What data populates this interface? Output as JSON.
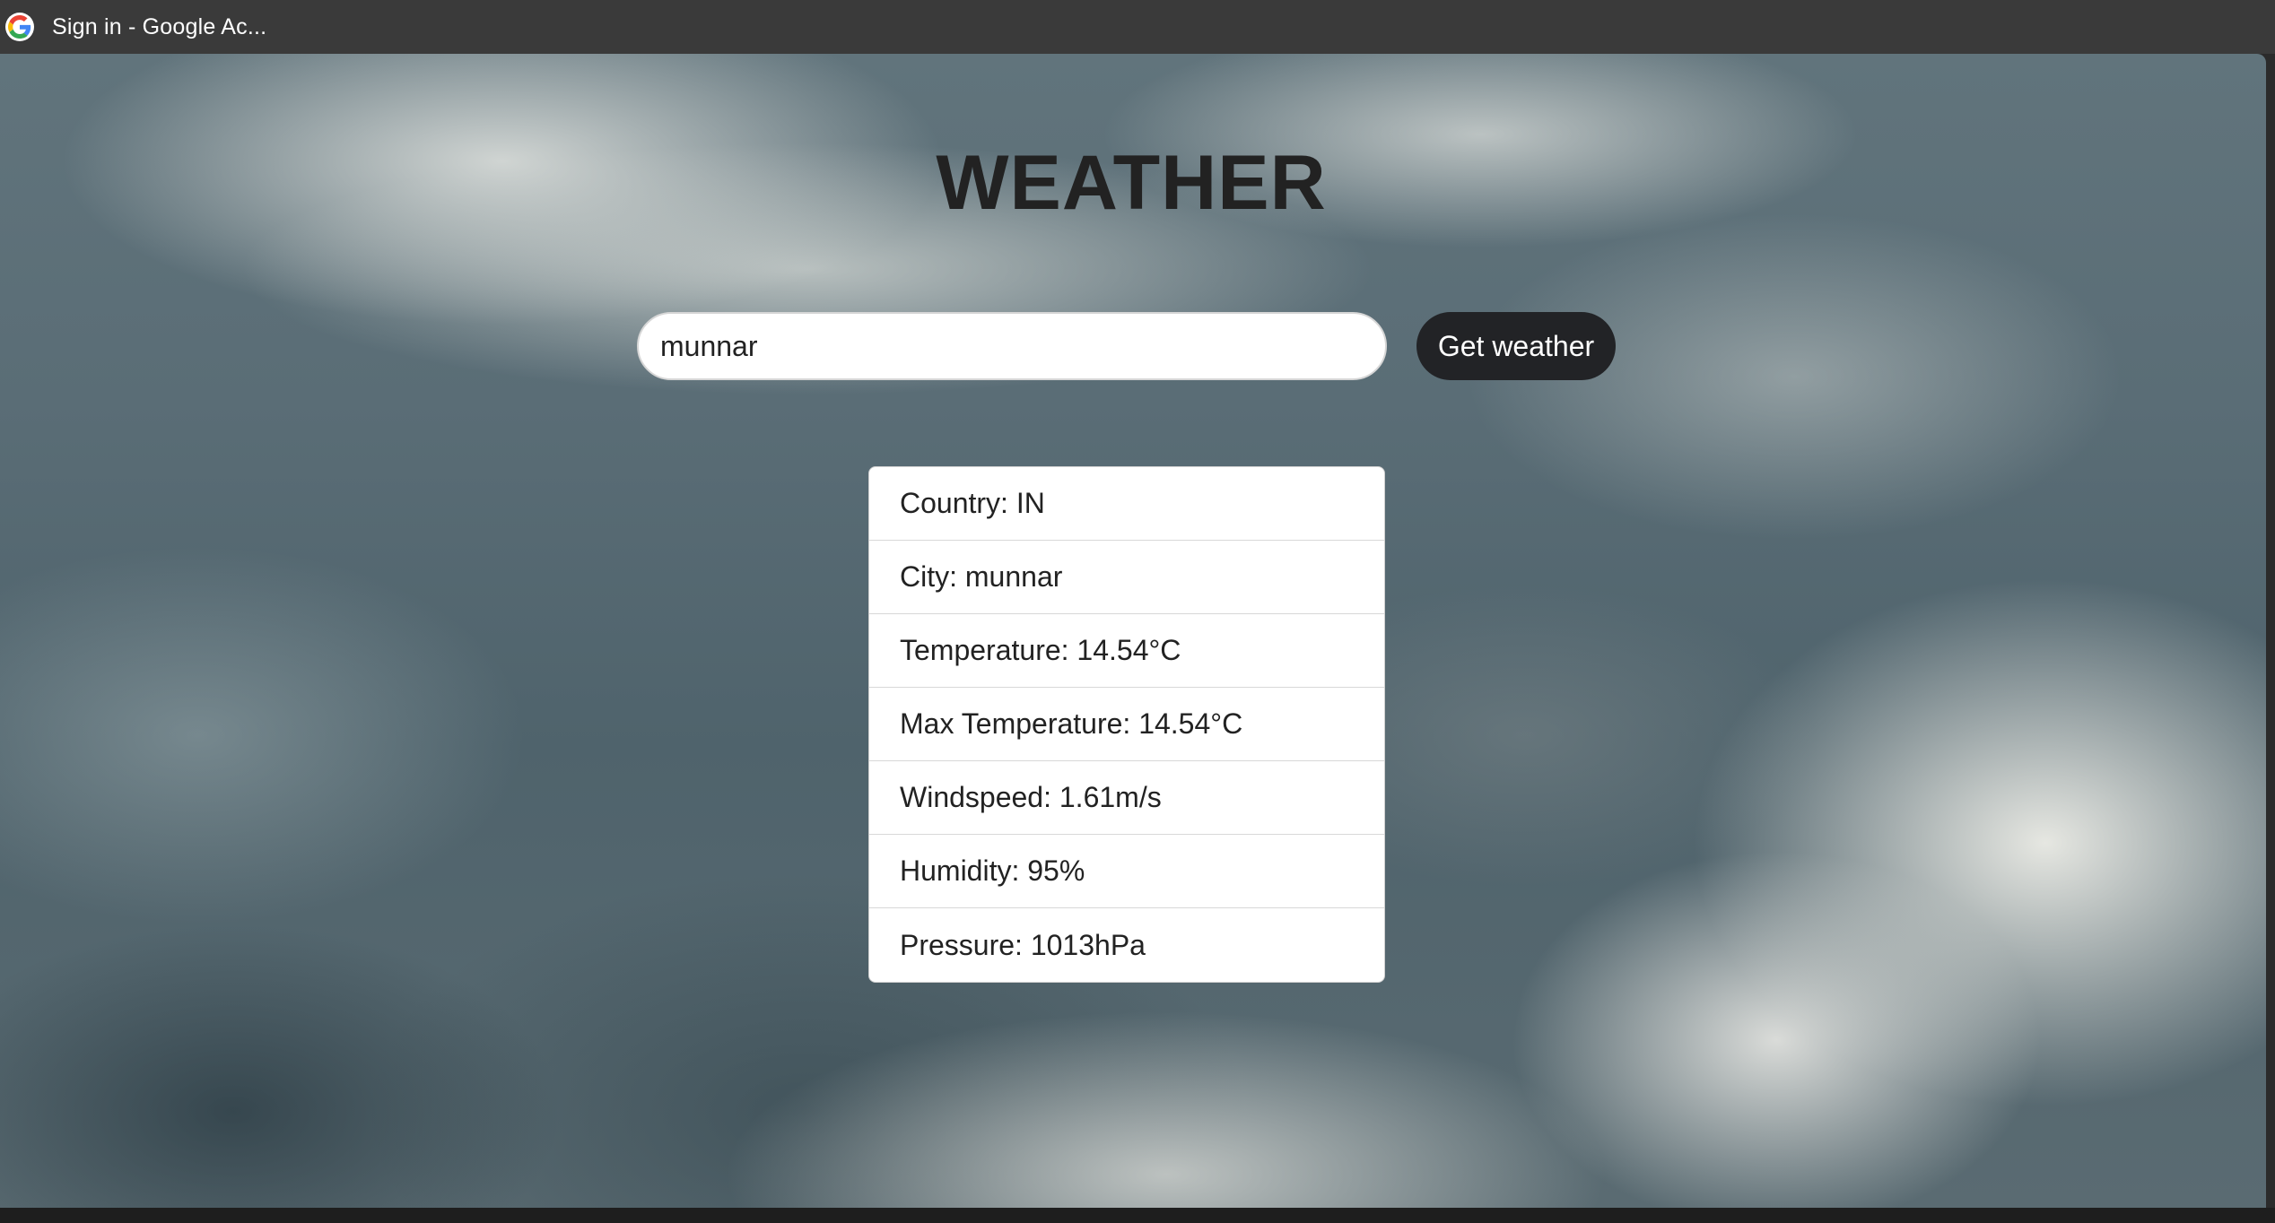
{
  "window": {
    "title": "Sign in - Google Ac...",
    "favicon": "google-g-icon"
  },
  "app": {
    "title": "WEATHER"
  },
  "search": {
    "value": "munnar",
    "placeholder": ""
  },
  "button": {
    "label": "Get weather"
  },
  "results": [
    {
      "label": "Country:",
      "value": "IN"
    },
    {
      "label": "City:",
      "value": "munnar"
    },
    {
      "label": "Temperature:",
      "value": "14.54°C"
    },
    {
      "label": "Max Temperature:",
      "value": "14.54°C"
    },
    {
      "label": "Windspeed:",
      "value": "1.61m/s"
    },
    {
      "label": "Humidity:",
      "value": "95%"
    },
    {
      "label": "Pressure:",
      "value": "1013hPa"
    }
  ],
  "colors": {
    "button_bg": "#222326",
    "title_text": "#222222"
  }
}
